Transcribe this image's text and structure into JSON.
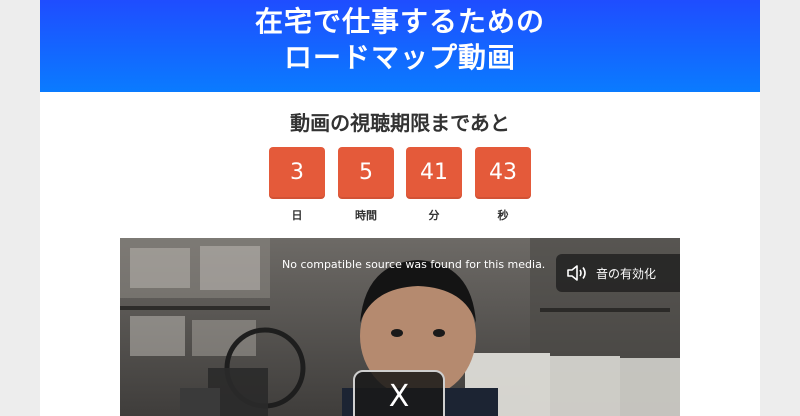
{
  "hero": {
    "line1": "在宅で仕事するための",
    "line2": "ロードマップ動画"
  },
  "deadline": {
    "title": "動画の視聴期限まであと"
  },
  "countdown": [
    {
      "value": "3",
      "label": "日"
    },
    {
      "value": "5",
      "label": "時間"
    },
    {
      "value": "41",
      "label": "分"
    },
    {
      "value": "43",
      "label": "秒"
    }
  ],
  "video": {
    "error_text": "No compatible source was found for this media.",
    "unmute_label": "音の有効化",
    "unmute_icon": "speaker-icon",
    "close_label": "X"
  },
  "colors": {
    "hero_top": "#1f4dff",
    "hero_bottom": "#0a7bff",
    "countdown_box": "#e45a3a"
  }
}
